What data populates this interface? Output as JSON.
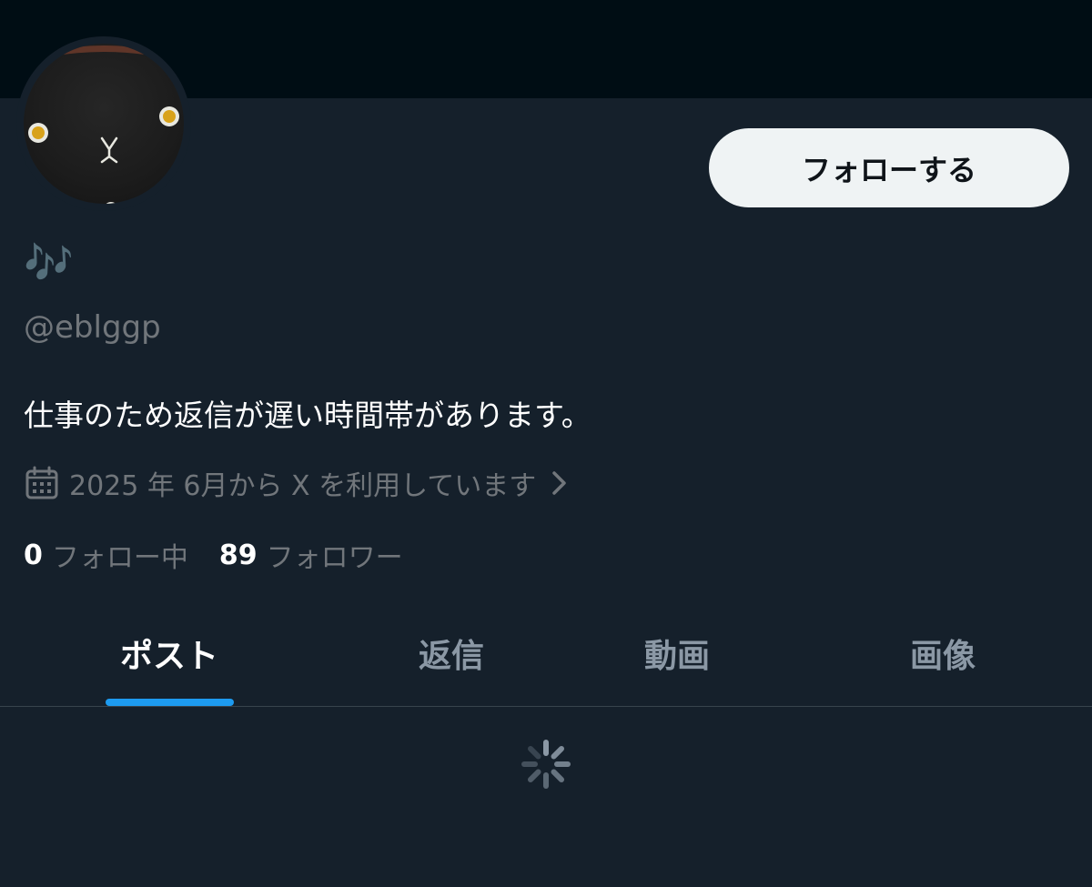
{
  "profile": {
    "display_name": "🎶",
    "handle": "@eblggp",
    "bio": "仕事のため返信が遅い時間帯があります。",
    "joined_text": "2025 年 6月から X を利用しています",
    "follow_button_label": "フォローする"
  },
  "stats": {
    "following_count": "0",
    "following_label": "フォロー中",
    "followers_count": "89",
    "followers_label": "フォロワー"
  },
  "tabs": [
    {
      "label": "ポスト",
      "active": true
    },
    {
      "label": "返信",
      "active": false
    },
    {
      "label": "動画",
      "active": false
    },
    {
      "label": "画像",
      "active": false
    }
  ],
  "colors": {
    "background": "#15202b",
    "banner": "#000d14",
    "accent": "#1d9bf0",
    "muted_text": "#71767b",
    "button_bg": "#eff3f4"
  },
  "icons": {
    "joined": "calendar-icon",
    "joined_arrow": "chevron-right-icon",
    "loading": "loading-spinner-icon"
  }
}
